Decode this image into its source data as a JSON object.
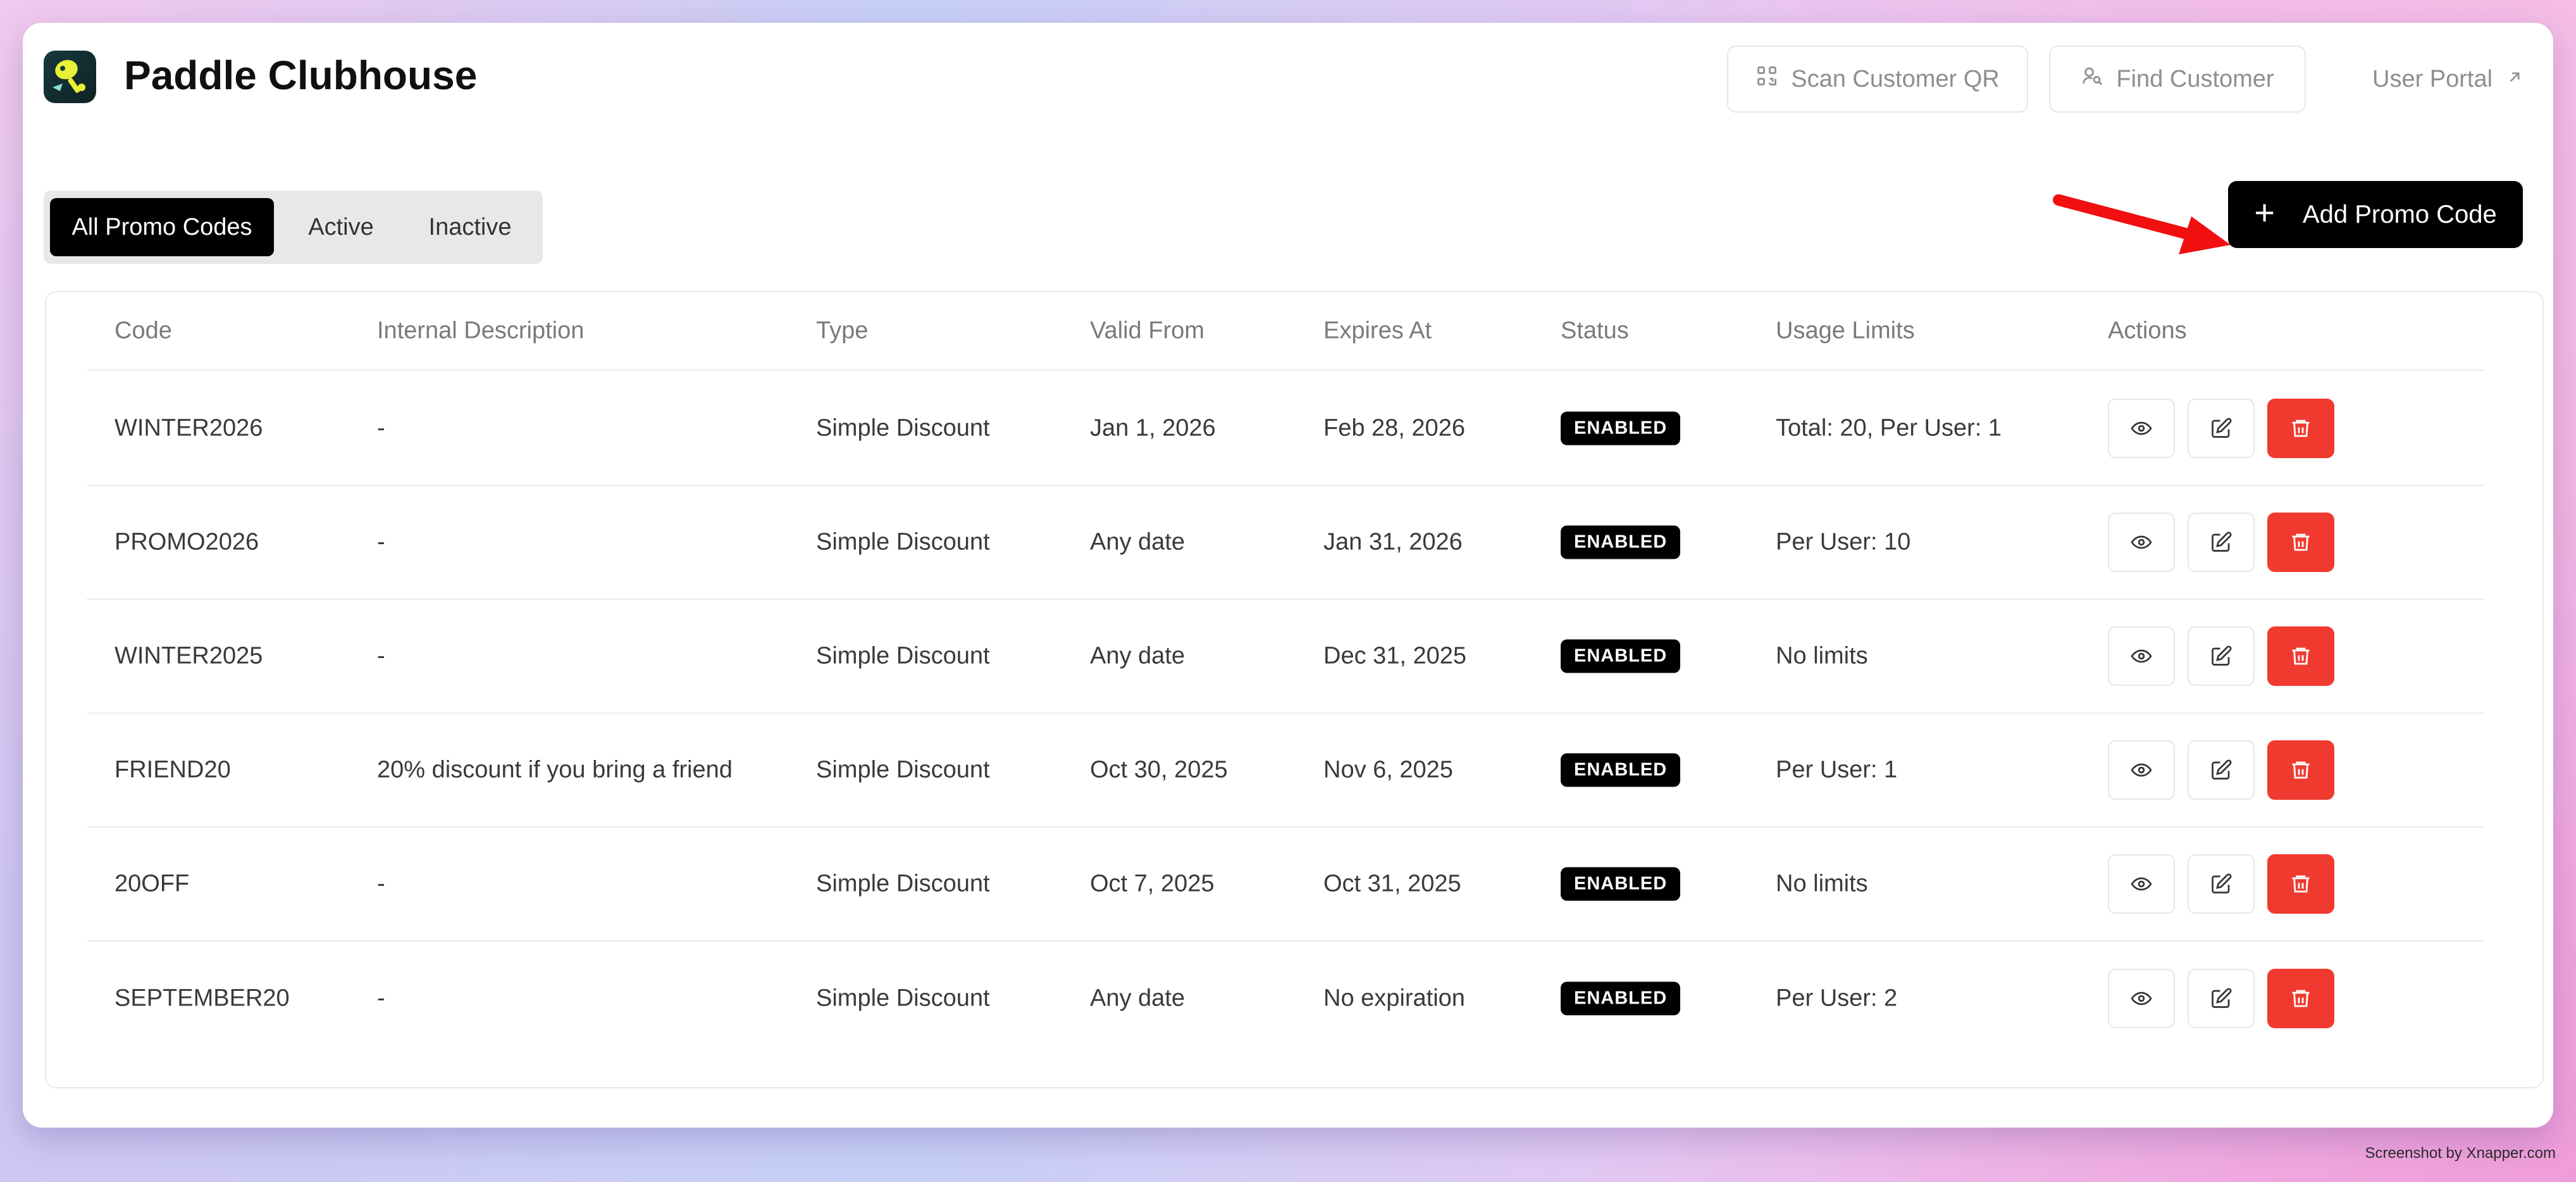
{
  "app": {
    "title": "Paddle Clubhouse"
  },
  "header": {
    "scan_label": "Scan Customer QR",
    "find_label": "Find Customer",
    "portal_label": "User Portal"
  },
  "tabs": [
    {
      "label": "All Promo Codes",
      "active": true
    },
    {
      "label": "Active",
      "active": false
    },
    {
      "label": "Inactive",
      "active": false
    }
  ],
  "add_button": {
    "label": "Add Promo Code"
  },
  "table": {
    "headers": [
      "Code",
      "Internal Description",
      "Type",
      "Valid From",
      "Expires At",
      "Status",
      "Usage Limits",
      "Actions"
    ],
    "rows": [
      {
        "code": "WINTER2026",
        "description": "-",
        "type": "Simple Discount",
        "valid_from": "Jan 1, 2026",
        "expires_at": "Feb 28, 2026",
        "status": "ENABLED",
        "usage": "Total: 20, Per User: 1"
      },
      {
        "code": "PROMO2026",
        "description": "-",
        "type": "Simple Discount",
        "valid_from": "Any date",
        "expires_at": "Jan 31, 2026",
        "status": "ENABLED",
        "usage": "Per User: 10"
      },
      {
        "code": "WINTER2025",
        "description": "-",
        "type": "Simple Discount",
        "valid_from": "Any date",
        "expires_at": "Dec 31, 2025",
        "status": "ENABLED",
        "usage": "No limits"
      },
      {
        "code": "FRIEND20",
        "description": "20% discount if you bring a friend",
        "type": "Simple Discount",
        "valid_from": "Oct 30, 2025",
        "expires_at": "Nov 6, 2025",
        "status": "ENABLED",
        "usage": "Per User: 1"
      },
      {
        "code": "20OFF",
        "description": "-",
        "type": "Simple Discount",
        "valid_from": "Oct 7, 2025",
        "expires_at": "Oct 31, 2025",
        "status": "ENABLED",
        "usage": "No limits"
      },
      {
        "code": "SEPTEMBER20",
        "description": "-",
        "type": "Simple Discount",
        "valid_from": "Any date",
        "expires_at": "No expiration",
        "status": "ENABLED",
        "usage": "Per User: 2"
      }
    ]
  },
  "icons": {
    "logo": "paddle-logo-icon",
    "scan": "qr-code-icon",
    "find": "user-search-icon",
    "portal": "arrow-up-right-icon",
    "add": "plus-icon",
    "view": "eye-icon",
    "edit": "edit-icon",
    "delete": "trash-icon",
    "annotation": "red-arrow-icon"
  },
  "colors": {
    "accent": "#000000",
    "danger": "#f03a2f",
    "annotation": "#f10f0f",
    "logo_bg": "#17383c",
    "logo_fg": "#e8f037"
  },
  "watermark": "Screenshot by Xnapper.com"
}
